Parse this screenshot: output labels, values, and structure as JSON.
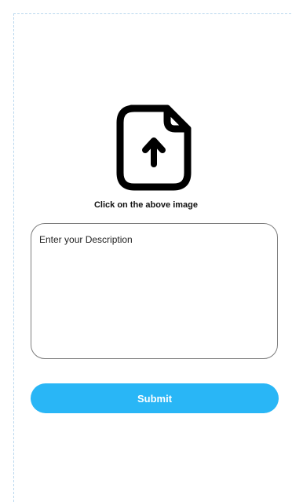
{
  "upload": {
    "icon": "file-upload-icon",
    "hint": "Click on the above image"
  },
  "description": {
    "placeholder": "Enter your Description",
    "value": ""
  },
  "submit": {
    "label": "Submit",
    "color": "#29b6f6"
  },
  "colors": {
    "background": "#ffffff",
    "border": "#7d7d7d",
    "accent": "#29b6f6",
    "text": "#111111"
  }
}
